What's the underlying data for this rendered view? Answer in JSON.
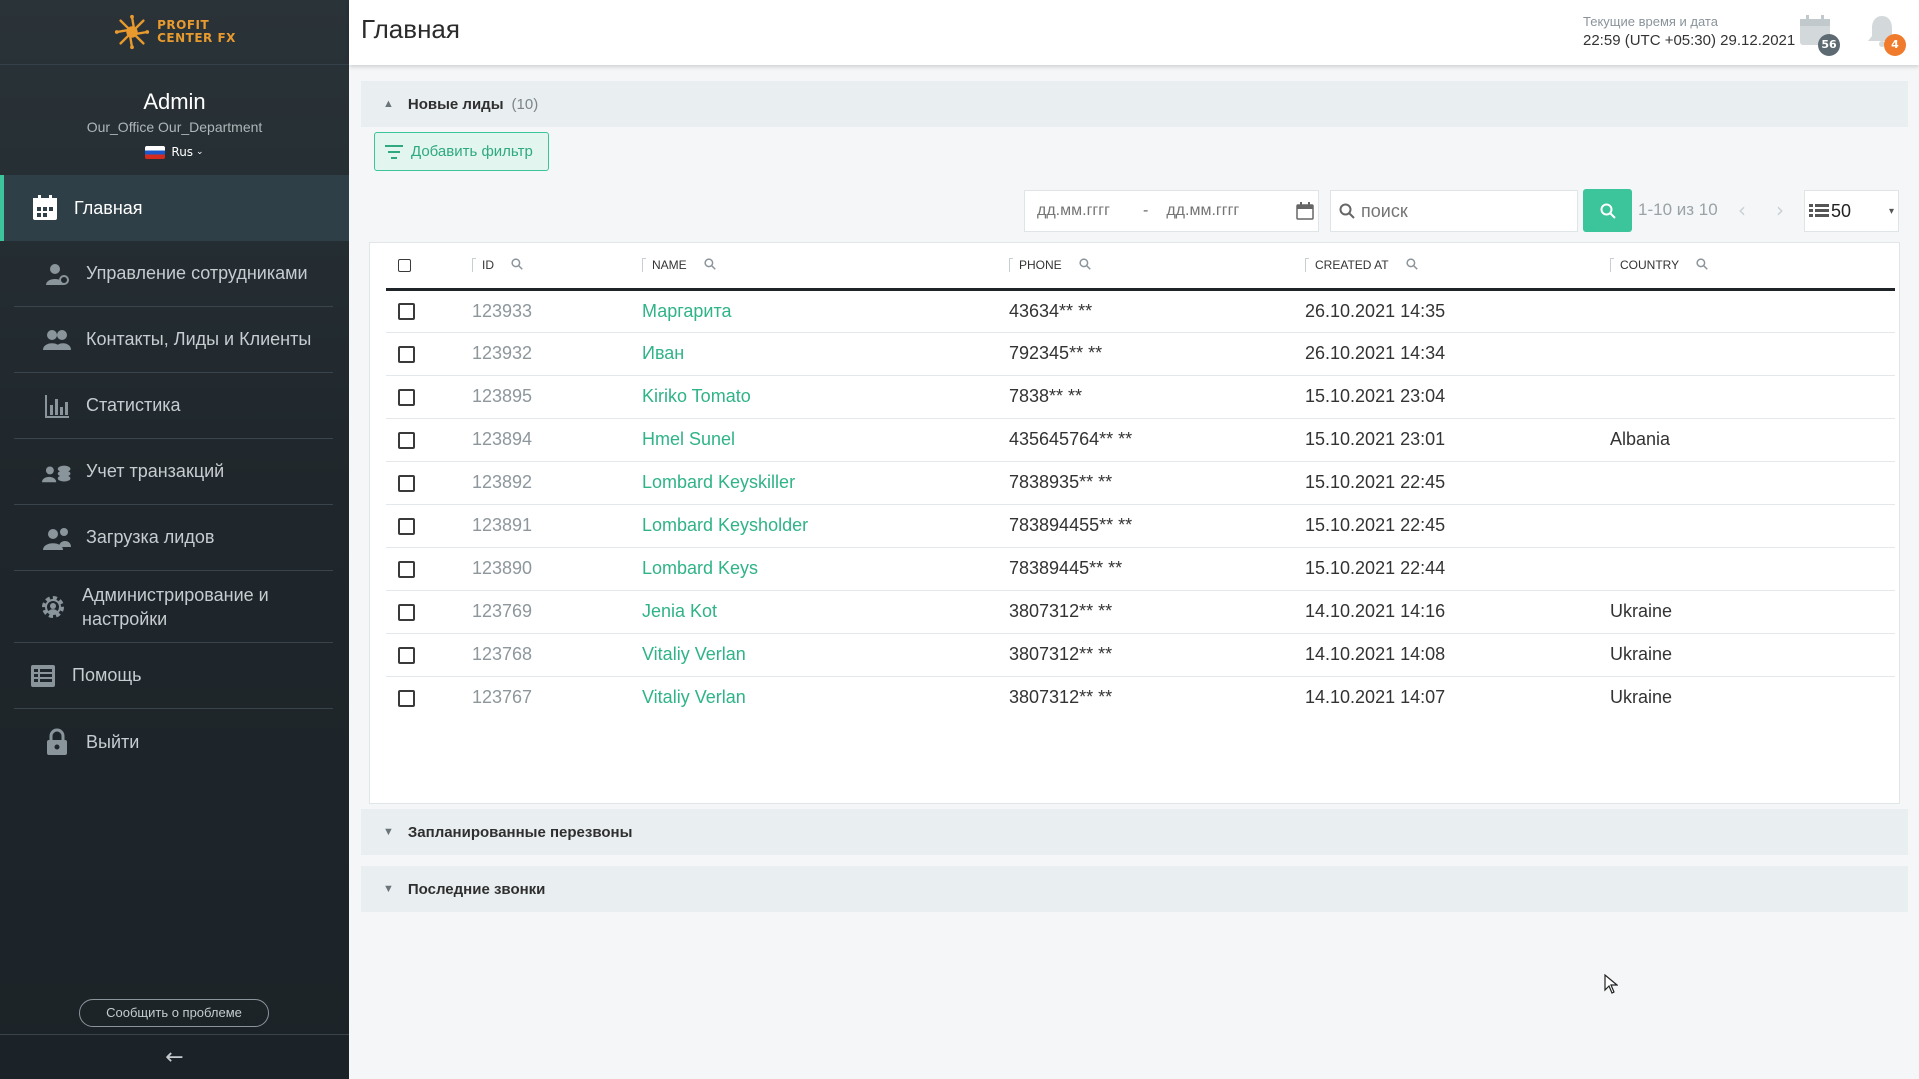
{
  "sidebar": {
    "logo_line1": "PROFIT",
    "logo_line2": "CENTER FX",
    "user_name": "Admin",
    "user_office": "Our_Office Our_Department",
    "language": "Rus",
    "items": [
      {
        "label": "Главная",
        "icon": "home-calendar-icon",
        "active": true
      },
      {
        "label": "Управление сотрудниками",
        "icon": "user-gear-icon"
      },
      {
        "label": "Контакты, Лиды и Клиенты",
        "icon": "users-icon"
      },
      {
        "label": "Статистика",
        "icon": "bar-chart-icon"
      },
      {
        "label": "Учет транзакций",
        "icon": "coins-icon"
      },
      {
        "label": "Загрузка лидов",
        "icon": "user-upload-icon"
      },
      {
        "label": "Администрирование и настройки",
        "icon": "gear-icon"
      },
      {
        "label": "Помощь",
        "icon": "help-list-icon"
      },
      {
        "label": "Выйти",
        "icon": "lock-icon"
      }
    ],
    "report_button": "Сообщить о проблеме",
    "collapse_icon": "arrow-left-icon"
  },
  "header": {
    "title": "Главная",
    "time_label": "Текущие время и дата",
    "time_value": "22:59 (UTC +05:30) 29.12.2021",
    "calendar_badge": "56",
    "notification_badge": "4"
  },
  "leads_panel": {
    "title": "Новые лиды",
    "count": "(10)",
    "add_filter": "Добавить фильтр",
    "date_from_placeholder": "дд.мм.гггг",
    "date_to_placeholder": "дд.мм.гггг",
    "date_separator": "-",
    "search_placeholder": "поиск",
    "pager": "1-10 из 10",
    "per_page": "50",
    "columns": [
      "ID",
      "NAME",
      "PHONE",
      "CREATED AT",
      "COUNTRY"
    ],
    "rows": [
      {
        "id": "123933",
        "name": "Маргарита",
        "phone": "43634** **",
        "created": "26.10.2021 14:35",
        "country": ""
      },
      {
        "id": "123932",
        "name": "Иван",
        "phone": "792345** **",
        "created": "26.10.2021 14:34",
        "country": ""
      },
      {
        "id": "123895",
        "name": "Kiriko Tomato",
        "phone": "7838** **",
        "created": "15.10.2021 23:04",
        "country": ""
      },
      {
        "id": "123894",
        "name": "Hmel Sunel",
        "phone": "435645764** **",
        "created": "15.10.2021 23:01",
        "country": "Albania"
      },
      {
        "id": "123892",
        "name": "Lombard Keyskiller",
        "phone": "7838935** **",
        "created": "15.10.2021 22:45",
        "country": ""
      },
      {
        "id": "123891",
        "name": "Lombard Keysholder",
        "phone": "783894455** **",
        "created": "15.10.2021 22:45",
        "country": ""
      },
      {
        "id": "123890",
        "name": "Lombard Keys",
        "phone": "78389445** **",
        "created": "15.10.2021 22:44",
        "country": ""
      },
      {
        "id": "123769",
        "name": "Jenia Kot",
        "phone": "3807312** **",
        "created": "14.10.2021 14:16",
        "country": "Ukraine"
      },
      {
        "id": "123768",
        "name": "Vitaliy Verlan",
        "phone": "3807312** **",
        "created": "14.10.2021 14:08",
        "country": "Ukraine"
      },
      {
        "id": "123767",
        "name": "Vitaliy Verlan",
        "phone": "3807312** **",
        "created": "14.10.2021 14:07",
        "country": "Ukraine"
      }
    ]
  },
  "callbacks_panel": {
    "title": "Запланированные перезвоны"
  },
  "calls_panel": {
    "title": "Последние звонки"
  },
  "colors": {
    "accent": "#3cc49a",
    "sidebar_bg": "#1f272c",
    "logo": "#e89a2e",
    "badge_gray": "#5d6a72",
    "badge_orange": "#f07b2c"
  }
}
